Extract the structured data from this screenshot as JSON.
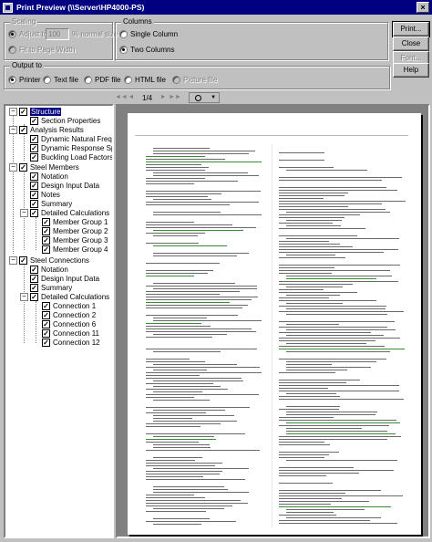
{
  "window": {
    "title": "Print Preview (\\\\Server\\HP4000-PS)"
  },
  "scaling": {
    "legend": "Scaling",
    "adjust_label": "Adjust to:",
    "adjust_value": "100",
    "normal_size_label": "% normal size",
    "fit_label": "Fit to Page Width"
  },
  "columns": {
    "legend": "Columns",
    "single_label": "Single Column",
    "two_label": "Two Columns"
  },
  "buttons": {
    "print": "Print...",
    "close": "Close",
    "font": "Font...",
    "help": "Help"
  },
  "output": {
    "legend": "Output to",
    "options": [
      "Printer",
      "Text file",
      "PDF file",
      "HTML file",
      "Picture file"
    ]
  },
  "toolbar": {
    "page_indicator": "1/4"
  },
  "tree": {
    "structure": "Structure",
    "section_properties": "Section Properties",
    "analysis_results": "Analysis Results",
    "dynamic_natural": "Dynamic Natural Frequen",
    "dynamic_response": "Dynamic Response Spec",
    "buckling": "Buckling Load Factors",
    "steel_members": "Steel Members",
    "notation": "Notation",
    "design_input": "Design Input Data",
    "notes": "Notes",
    "summary": "Summary",
    "detailed_calc": "Detailed Calculations",
    "mg1": "Member Group 1",
    "mg2": "Member Group 2",
    "mg3": "Member Group 3",
    "mg4": "Member Group 4",
    "steel_connections": "Steel Connections",
    "c_notation": "Notation",
    "c_design_input": "Design Input Data",
    "c_summary": "Summary",
    "c_detailed_calc": "Detailed Calculations",
    "conn1": "Connection 1",
    "conn2": "Connection 2",
    "conn6": "Connection 6",
    "conn11": "Connection 11",
    "conn12": "Connection 12"
  }
}
